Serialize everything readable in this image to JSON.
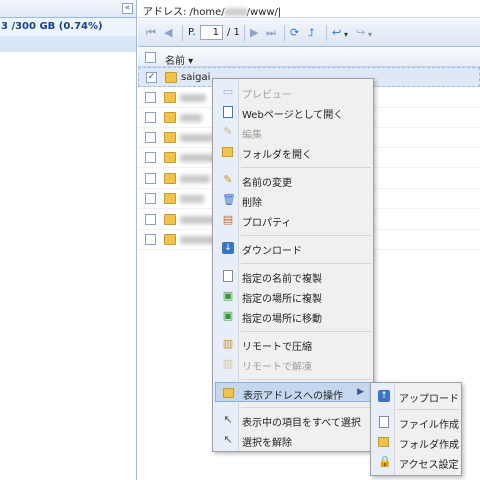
{
  "left": {
    "collapse_glyph": "«",
    "disk_usage": "3 /300 GB (0.74%)"
  },
  "address": {
    "label": "アドレス: /home/",
    "suffix": "/www/"
  },
  "toolbar": {
    "first": "⏮",
    "prev": "◀",
    "page_label": "P.",
    "page_value": "1",
    "page_total": "/ 1",
    "next": "▶",
    "last": "⏭",
    "refresh": "⟳",
    "up": "⮥",
    "back": "↩",
    "forward": "↪"
  },
  "grid": {
    "column_name": "名前 ▾",
    "selected_item": "saigai",
    "rows": [
      {
        "name": "saigai",
        "checked": true
      },
      {
        "blur_width": 26
      },
      {
        "blur_width": 22
      },
      {
        "blur_width": 34
      },
      {
        "blur_width": 40
      },
      {
        "blur_width": 30
      },
      {
        "blur_width": 24
      },
      {
        "blur_width": 36
      },
      {
        "blur_width": 42
      }
    ]
  },
  "menu": {
    "preview": "プレビュー",
    "open_web": "Webページとして開く",
    "edit": "編集",
    "open_folder": "フォルダを開く",
    "rename": "名前の変更",
    "delete": "削除",
    "properties": "プロパティ",
    "download": "ダウンロード",
    "copy_named": "指定の名前で複製",
    "copy_to": "指定の場所に複製",
    "move_to": "指定の場所に移動",
    "compress": "リモートで圧縮",
    "extract": "リモートで解凍",
    "address_ops": "表示アドレスへの操作",
    "select_all": "表示中の項目をすべて選択",
    "deselect": "選択を解除"
  },
  "submenu": {
    "upload": "アップロード",
    "new_file": "ファイル作成",
    "new_folder": "フォルダ作成",
    "access": "アクセス設定"
  },
  "colors": {
    "accent": "#3b73c8",
    "folder": "#f0c24e",
    "selection": "#dfe8f6"
  }
}
